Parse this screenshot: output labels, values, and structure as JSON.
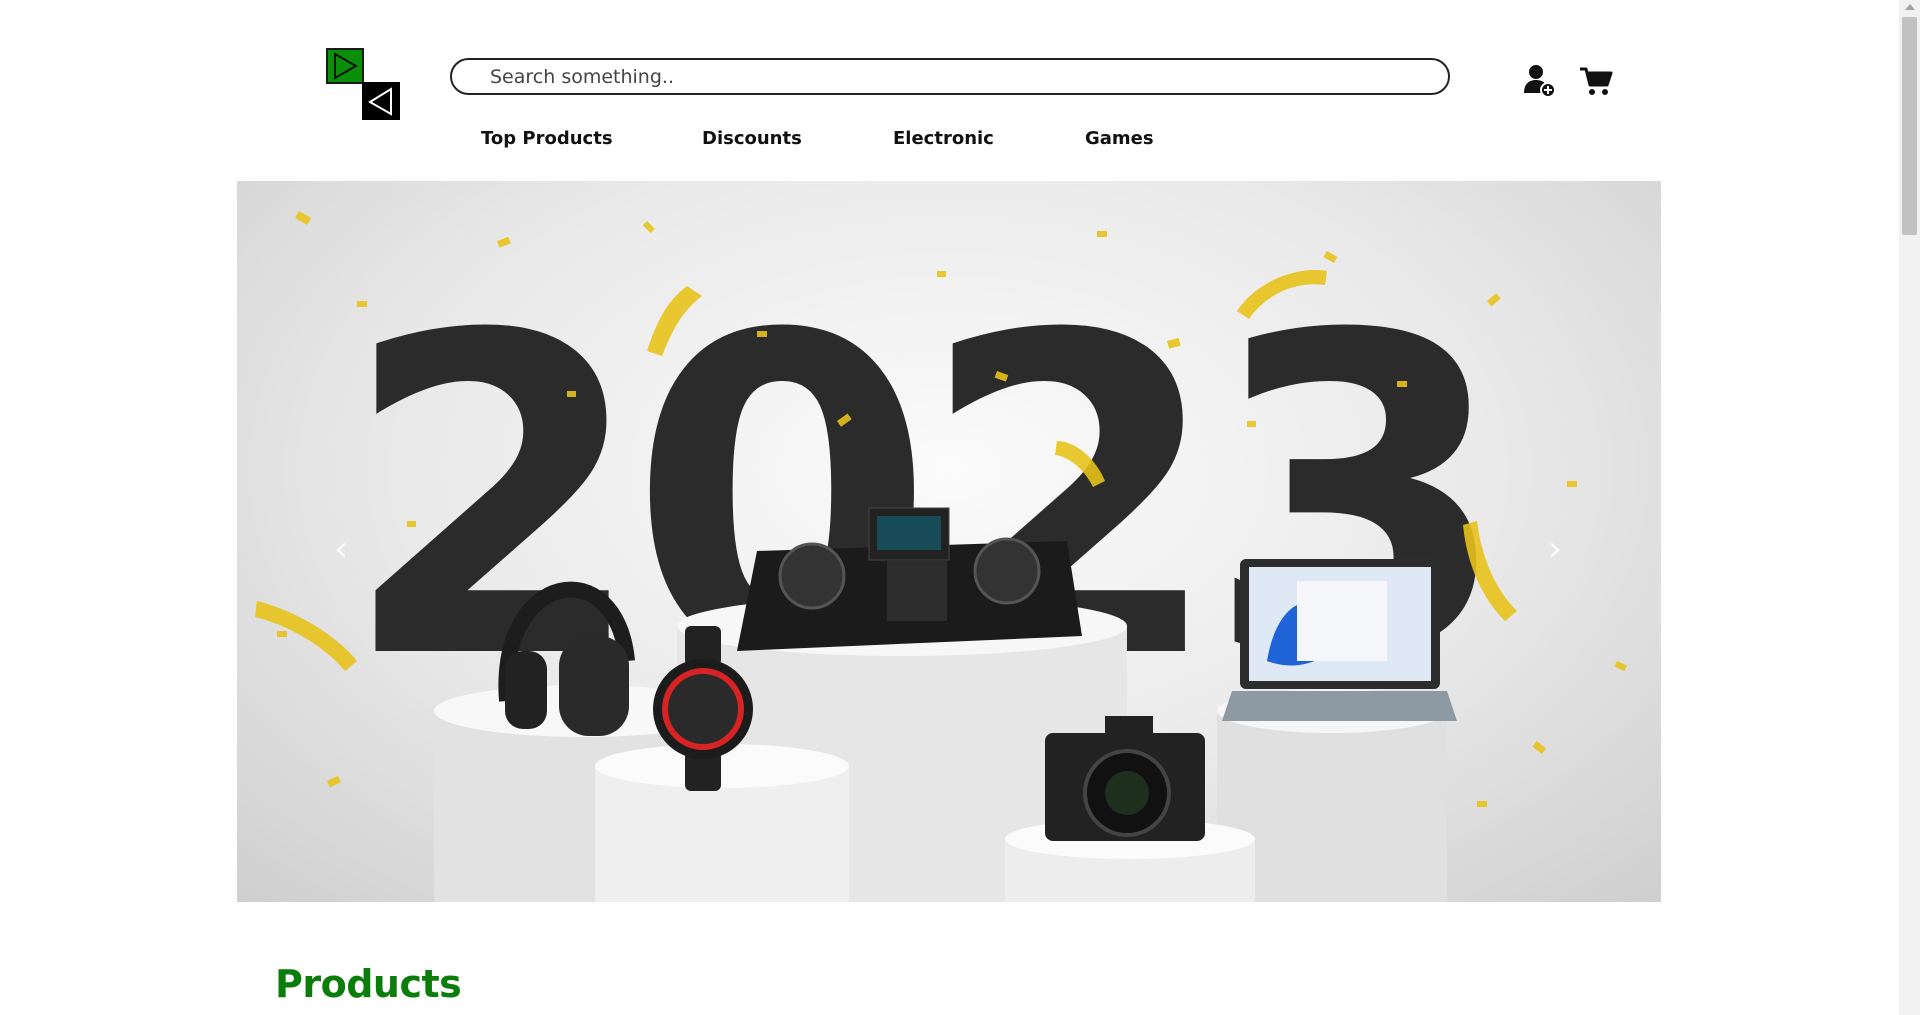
{
  "header": {
    "logo_name": "logo",
    "search": {
      "placeholder": "Search something..",
      "value": ""
    },
    "icons": {
      "account": "user-plus-icon",
      "cart": "shopping-cart-icon"
    }
  },
  "nav": {
    "items": [
      {
        "label": "Top Products"
      },
      {
        "label": "Discounts"
      },
      {
        "label": "Electronic"
      },
      {
        "label": "Games"
      }
    ]
  },
  "banner": {
    "year_text": "2023",
    "prev_label": "‹",
    "next_label": "›",
    "products": [
      "headphones",
      "smartwatch",
      "dj-controller",
      "camera",
      "laptop"
    ]
  },
  "products_section": {
    "title": "Products"
  },
  "colors": {
    "brand_green": "#0a7d0a",
    "logo_green": "#0b8f0b",
    "confetti_gold": "#e8c21a",
    "digits": "#2b2b2b"
  }
}
